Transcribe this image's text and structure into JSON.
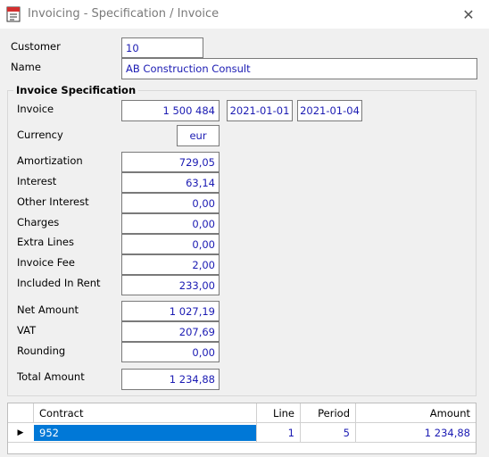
{
  "window": {
    "title": "Invoicing - Specification / Invoice",
    "icon": "invoice-app-icon",
    "close_glyph": "✕"
  },
  "customer": {
    "label": "Customer",
    "value": "10"
  },
  "name": {
    "label": "Name",
    "value": "AB Construction Consult"
  },
  "spec": {
    "title": "Invoice Specification",
    "invoice_label": "Invoice",
    "invoice_amount": "1 500 484",
    "date_from": "2021-01-01",
    "date_to": "2021-01-04",
    "currency_label": "Currency",
    "currency_value": "eur",
    "amortization_label": "Amortization",
    "amortization_value": "729,05",
    "interest_label": "Interest",
    "interest_value": "63,14",
    "other_interest_label": "Other Interest",
    "other_interest_value": "0,00",
    "charges_label": "Charges",
    "charges_value": "0,00",
    "extra_lines_label": "Extra Lines",
    "extra_lines_value": "0,00",
    "invoice_fee_label": "Invoice Fee",
    "invoice_fee_value": "2,00",
    "included_in_rent_label": "Included In Rent",
    "included_in_rent_value": "233,00",
    "net_amount_label": "Net Amount",
    "net_amount_value": "1 027,19",
    "vat_label": "VAT",
    "vat_value": "207,69",
    "rounding_label": "Rounding",
    "rounding_value": "0,00",
    "total_amount_label": "Total Amount",
    "total_amount_value": "1 234,88"
  },
  "grid": {
    "headers": {
      "contract": "Contract",
      "line": "Line",
      "period": "Period",
      "amount": "Amount"
    },
    "rows": [
      {
        "marker": "▶",
        "contract": "952",
        "line": "1",
        "period": "5",
        "amount": "1 234,88"
      }
    ]
  },
  "colors": {
    "value_text": "#1b1bb3",
    "selection": "#0078d7"
  }
}
